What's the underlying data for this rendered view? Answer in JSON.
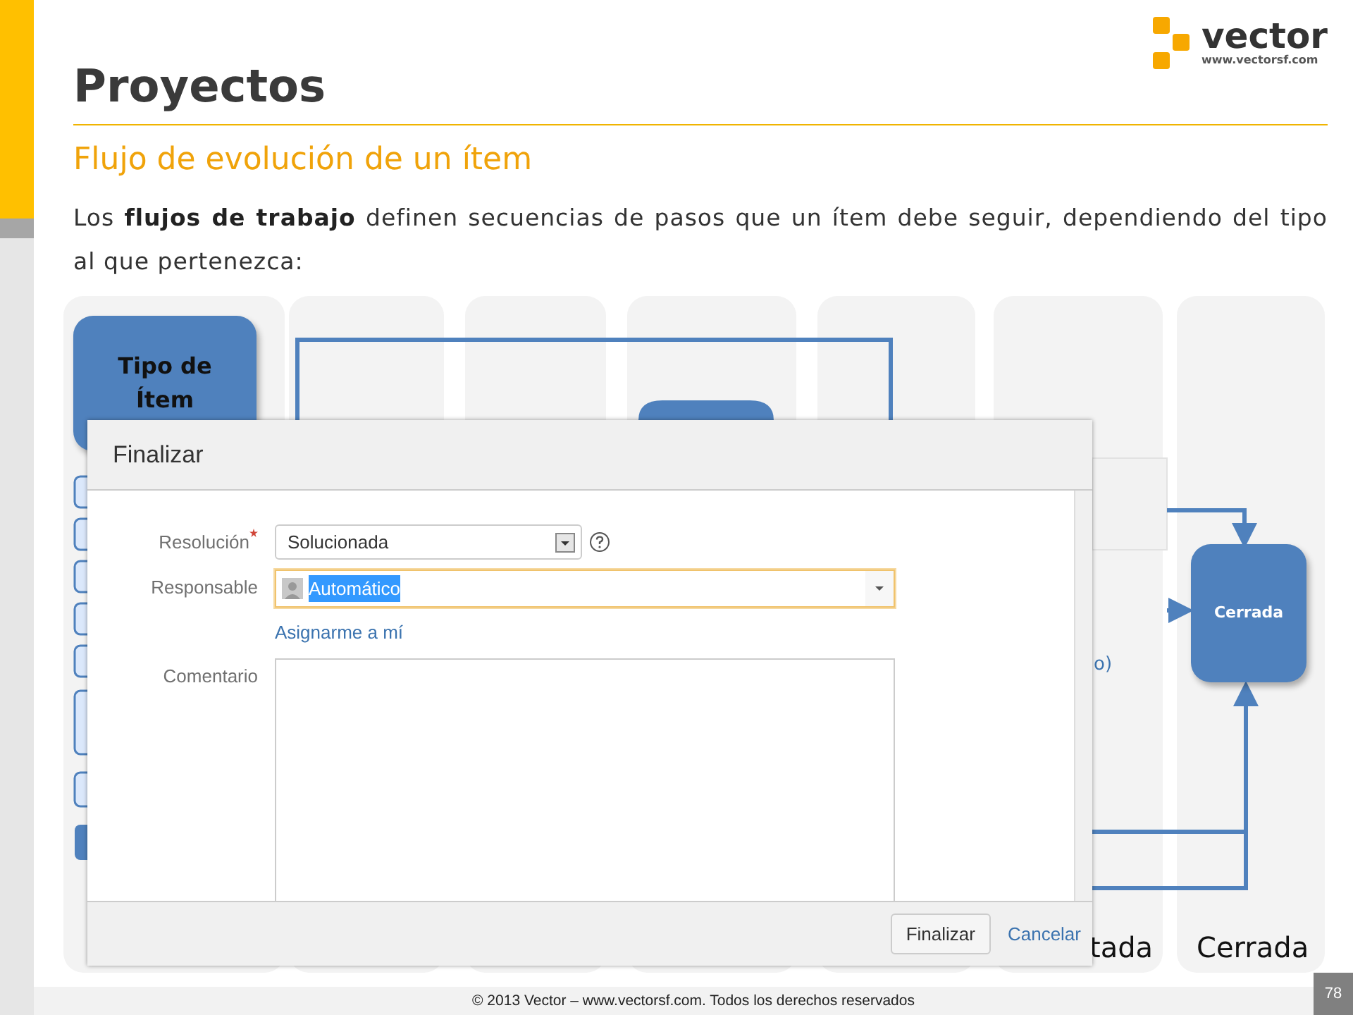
{
  "logo": {
    "name": "vector",
    "url": "www.vectorsf.com"
  },
  "title": "Proyectos",
  "subtitle": "Flujo de evolución de un ítem",
  "intro": "Los **flujos de trabajo** definen secuencias de pasos que un ítem debe seguir, dependiendo del tipo al que pertenezca:",
  "diagram": {
    "nodes": [
      {
        "label": "Tipo de Ítem",
        "kind": "type"
      },
      {
        "label": "Cerrada",
        "kind": "state"
      }
    ],
    "column_labels": [
      "tada",
      "Cerrada"
    ],
    "fragment": "o)"
  },
  "dialog": {
    "title": "Finalizar",
    "fields": [
      {
        "kind": "select",
        "label": "Resolución",
        "required": true,
        "value": "Solucionada",
        "focused": false
      },
      {
        "kind": "user",
        "label": "Responsable",
        "required": false,
        "value": "Automático",
        "focused": true
      },
      {
        "kind": "link",
        "label": "Asignarme a mí"
      },
      {
        "kind": "textarea",
        "label": "Comentario",
        "required": false,
        "focused": false
      }
    ],
    "buttons": [
      {
        "kind": "button",
        "label": "Finalizar"
      },
      {
        "kind": "link",
        "label": "Cancelar"
      }
    ]
  },
  "footer": "© 2013 Vector – www.vectorsf.com. Todos los derechos reservados",
  "page_number": "78"
}
